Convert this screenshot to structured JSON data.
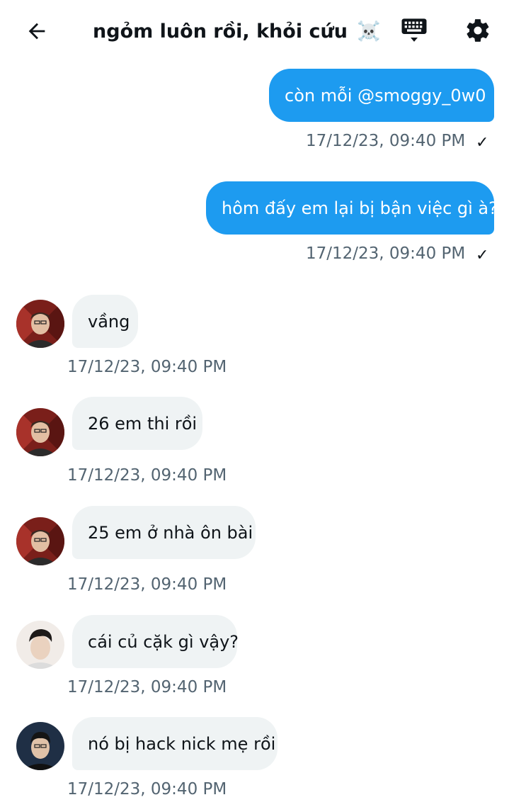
{
  "header": {
    "title": "ngỏm luôn rồi, khỏi cứu",
    "title_emoji": "☠️",
    "back_icon": "arrow-left-icon",
    "keyboard_icon": "keyboard-icon",
    "settings_icon": "gear-icon"
  },
  "colors": {
    "accent": "#1d9bf0",
    "incoming_bubble": "#eff3f4",
    "timestamp": "#536471"
  },
  "messages": [
    {
      "direction": "out",
      "text": "còn mỗi @smoggy_0w0",
      "time": "17/12/23, 09:40 PM",
      "read_mark": "✓"
    },
    {
      "direction": "out",
      "text": "hôm đấy em lại bị bận việc gì à?",
      "time": "17/12/23, 09:40 PM",
      "read_mark": "✓"
    },
    {
      "direction": "in",
      "text": "vầng",
      "time": "17/12/23, 09:40 PM"
    },
    {
      "direction": "in",
      "text": "26 em thi rồi",
      "time": "17/12/23, 09:40 PM"
    },
    {
      "direction": "in",
      "text": "25 em ở nhà ôn bài",
      "time": "17/12/23, 09:40 PM"
    },
    {
      "direction": "in",
      "text": "cái củ cặk gì vậy?",
      "time": "17/12/23, 09:40 PM"
    },
    {
      "direction": "in",
      "text": "nó bị hack nick mẹ rồi",
      "time": "17/12/23, 09:40 PM"
    }
  ]
}
